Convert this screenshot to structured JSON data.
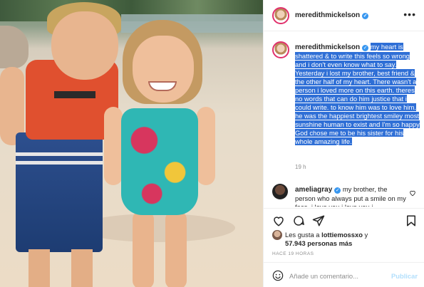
{
  "post": {
    "photo_alt": "Two children smiling on a beach",
    "author": "meredithmickelson",
    "caption": {
      "author": "meredithmickelson",
      "text": "my heart is shattered & to write this feels so wrong and i don't even know what to say. Yesterday i lost my brother, best friend & the other half of my heart. There wasn't a person i loved more on this earth. theres no words that can do him justice that i could write. to know him was to love him. he was the happiest brightest smiley most sunshine human to exist and I'm so happy God chose me to be his sister for his whole amazing life."
    },
    "caption_time": "19 h",
    "comment": {
      "author": "ameliagray",
      "text": "my brother, the person who always put a smile on my face. i love you i love you i"
    },
    "likes": {
      "prefix": "Les gusta a",
      "user": "lottiemossxo",
      "suffix": "y",
      "count_text": "57.943 personas más"
    },
    "time_ago": "HACE 19 HORAS",
    "add_comment": {
      "placeholder": "Añade un comentario...",
      "publish_label": "Publicar"
    }
  },
  "colors": {
    "verified": "#3897f0",
    "highlight": "#2f6fd6",
    "publish": "#b2dffc"
  }
}
